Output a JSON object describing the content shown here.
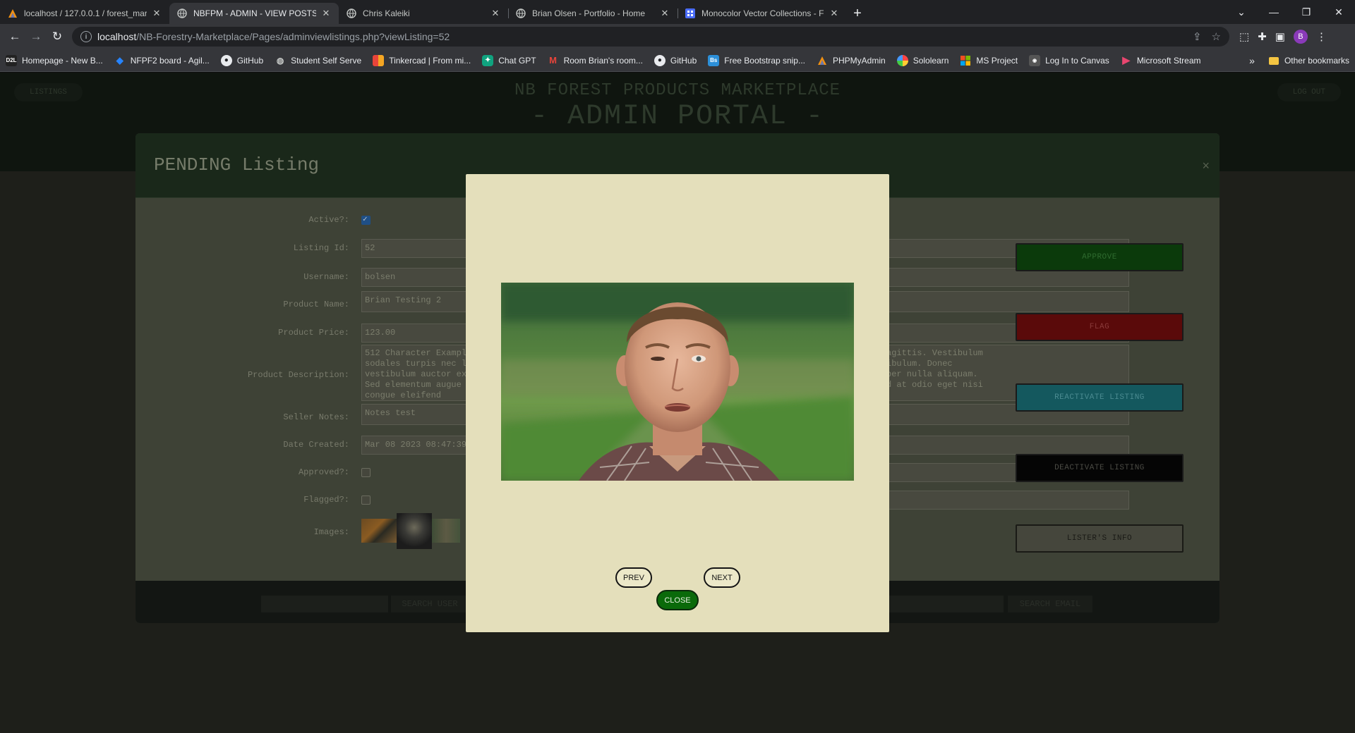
{
  "browser": {
    "tabs": [
      {
        "title": "localhost / 127.0.0.1 / forest_mar",
        "icon": "phpmyadmin-icon",
        "active": false
      },
      {
        "title": "NBFPM - ADMIN - VIEW POSTS",
        "icon": "globe-icon",
        "active": true
      },
      {
        "title": "Chris Kaleiki",
        "icon": "globe-icon",
        "active": false
      },
      {
        "title": "Brian Olsen - Portfolio - Home",
        "icon": "globe-icon",
        "active": false
      },
      {
        "title": "Monocolor Vector Collections - F",
        "icon": "svgrepo-icon",
        "active": false
      }
    ],
    "address": {
      "host": "localhost",
      "path": "/NB-Forestry-Marketplace/Pages/adminviewlistings.php?viewListing=52"
    },
    "bookmarks": [
      {
        "label": "Homepage - New B...",
        "icon": "d2l-icon",
        "color": "#222222"
      },
      {
        "label": "NFPF2 board - Agil...",
        "icon": "jira-icon",
        "color": "#2684ff"
      },
      {
        "label": "GitHub",
        "icon": "github-icon",
        "color": "#35363a"
      },
      {
        "label": "Student Self Serve",
        "icon": "globe-icon",
        "color": "#35363a"
      },
      {
        "label": "Tinkercad | From mi...",
        "icon": "tinkercad-icon",
        "color": "#e8443a"
      },
      {
        "label": "Chat GPT",
        "icon": "openai-icon",
        "color": "#10a37f"
      },
      {
        "label": "Room Brian's room...",
        "icon": "miro-icon",
        "color": "#35363a"
      },
      {
        "label": "GitHub",
        "icon": "github-icon",
        "color": "#35363a"
      },
      {
        "label": "Free Bootstrap snip...",
        "icon": "bootsnipp-icon",
        "color": "#2c8fd8"
      },
      {
        "label": "PHPMyAdmin",
        "icon": "phpmyadmin-icon",
        "color": "#35363a"
      },
      {
        "label": "Sololearn",
        "icon": "sololearn-icon",
        "color": "#35363a"
      },
      {
        "label": "MS Project",
        "icon": "microsoft-icon",
        "color": "#35363a"
      },
      {
        "label": "Log In to Canvas",
        "icon": "canvas-icon",
        "color": "#35363a"
      },
      {
        "label": "Microsoft Stream",
        "icon": "stream-icon",
        "color": "#35363a"
      }
    ],
    "other_bookmarks": "Other bookmarks",
    "profile_initial": "B"
  },
  "header": {
    "brand_line1": "NB FOREST PRODUCTS MARKETPLACE",
    "brand_line2": "- ADMIN PORTAL -",
    "left_button": "LISTINGS",
    "right_button": "LOG OUT"
  },
  "panel": {
    "title": "PENDING Listing",
    "close": "×",
    "fields": {
      "active_label": "Active?:",
      "listing_id_label": "Listing Id:",
      "listing_id": "52",
      "username_label": "Username:",
      "username": "bolsen",
      "product_name_label": "Product Name:",
      "product_name": "Brian Testing 2",
      "product_price_label": "Product Price:",
      "product_price": "123.00",
      "product_description_label": "Product Description:",
      "product_description_left": "512 Character Example\nsodales turpis nec le\nvestibulum auctor ex\nSed elementum augue l\ncongue eleifend",
      "product_description_right": "agittis. Vestibulum\nibulum. Donec\nper nulla aliquam.\nd at odio eget nisi",
      "seller_notes_label": "Seller Notes:",
      "seller_notes": "Notes test",
      "date_created_label": "Date Created:",
      "date_created": "Mar 08 2023 08:47:39",
      "approved_label": "Approved?:",
      "flagged_label": "Flagged?:",
      "images_label": "Images:"
    },
    "actions": {
      "approve": "APPROVE",
      "flag": "FLAG",
      "reactivate": "REACTIVATE LISTING",
      "deactivate": "DEACTIVATE LISTING",
      "listers_info": "LISTER'S INFO"
    },
    "footer": {
      "search_user": "SEARCH USER",
      "search_email": "SEARCH EMAIL"
    }
  },
  "modal": {
    "prev": "PREV",
    "next": "NEXT",
    "close": "CLOSE"
  },
  "colors": {
    "approve": "#0b3a0b",
    "flag": "#5a0a0a",
    "reactivate": "#14585e",
    "deactivate": "#050505",
    "modal_bg": "#e4dfbb",
    "close_green": "#0a6a0a"
  }
}
